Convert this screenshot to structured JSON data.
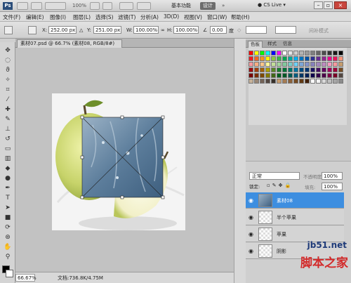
{
  "titlebar": {
    "logo": "Ps",
    "zoom": "100%",
    "workspace_basic": "基本功能",
    "workspace_design": "设计",
    "cslive": "CS Live"
  },
  "menu": [
    "文件(F)",
    "编辑(E)",
    "图像(I)",
    "图层(L)",
    "选择(S)",
    "滤镜(T)",
    "分析(A)",
    "3D(D)",
    "视图(V)",
    "窗口(W)",
    "帮助(H)"
  ],
  "options": {
    "x_label": "X:",
    "x_value": "252.00 px",
    "y_label": "Y:",
    "y_value": "251.00 px",
    "w_label": "W:",
    "w_value": "100.00%",
    "h_label": "H:",
    "h_value": "100.00%",
    "angle_value": "0.00",
    "skew_label": "度",
    "interp_label": "间补模式"
  },
  "document": {
    "tab_title": "素材07.psd @ 66.7% (素材08, RGB/8#)",
    "zoom": "66.67%",
    "doc_info": "文档:736.8K/4.75M"
  },
  "swatches_panel": {
    "tabs": [
      "色板",
      "样式",
      "信息"
    ]
  },
  "layers_panel": {
    "tabs": [
      "图层",
      "通道",
      "路径"
    ],
    "blend_mode": "正常",
    "opacity_label": "不透明度:",
    "opacity": "100%",
    "lock_label": "锁定:",
    "fill_label": "填充:",
    "fill": "100%",
    "layers": [
      {
        "name": "素材08",
        "selected": true
      },
      {
        "name": "半个苹果",
        "selected": false
      },
      {
        "name": "苹果",
        "selected": false
      },
      {
        "name": "阴影",
        "selected": false
      }
    ]
  },
  "watermark": {
    "site": "jb51.net",
    "brand": "脚本之家"
  },
  "colors": {
    "layer_selected": "#3d8ee0",
    "panel_bg": "#c9c9c9",
    "canvas_bg": "#c2c2c2"
  }
}
